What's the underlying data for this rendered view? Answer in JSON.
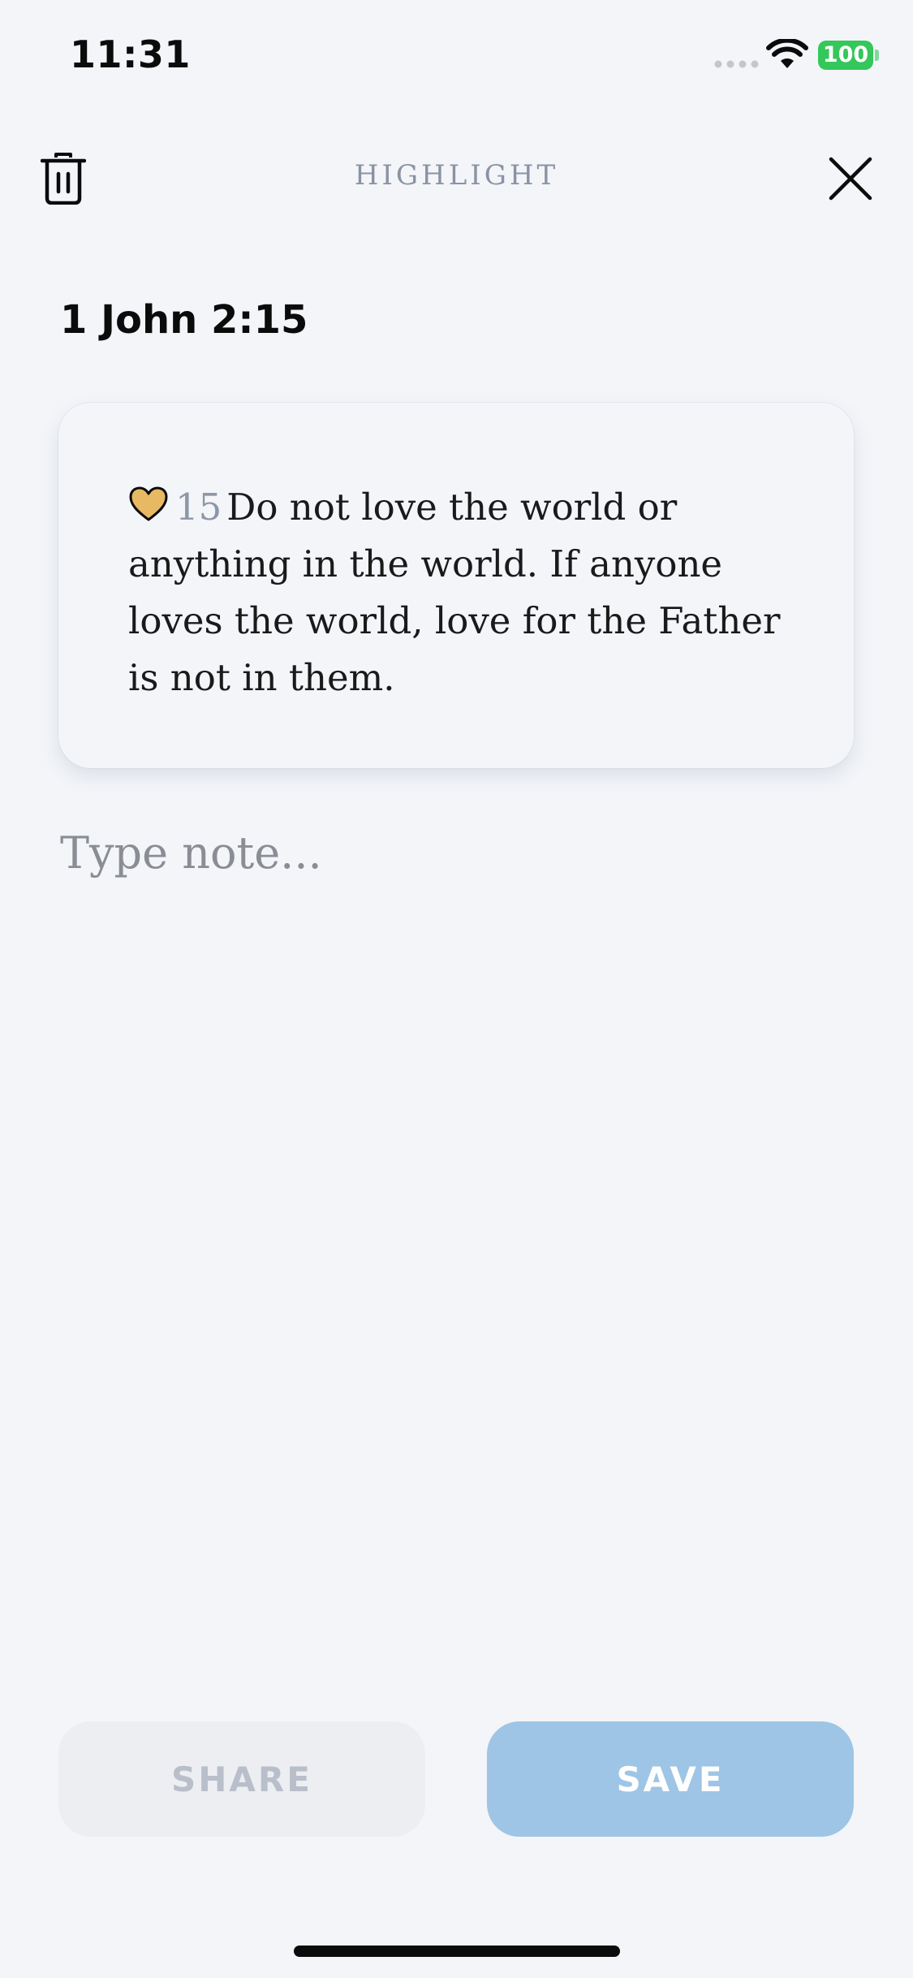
{
  "status_bar": {
    "time": "11:31",
    "battery": "100",
    "battery_color": "#34c759"
  },
  "header": {
    "title": "HIGHLIGHT",
    "left_icon": "trash-icon",
    "right_icon": "close-icon"
  },
  "reference": "1 John 2:15",
  "verse": {
    "icon": "heart-icon",
    "icon_color": "#e7b962",
    "number": "15",
    "text": "Do not love the world or anything in the world. If anyone loves the world, love for the Father is not in them."
  },
  "note": {
    "placeholder": "Type note...",
    "value": ""
  },
  "actions": {
    "share_label": "SHARE",
    "save_label": "SAVE",
    "save_color": "#9ec5e5"
  }
}
